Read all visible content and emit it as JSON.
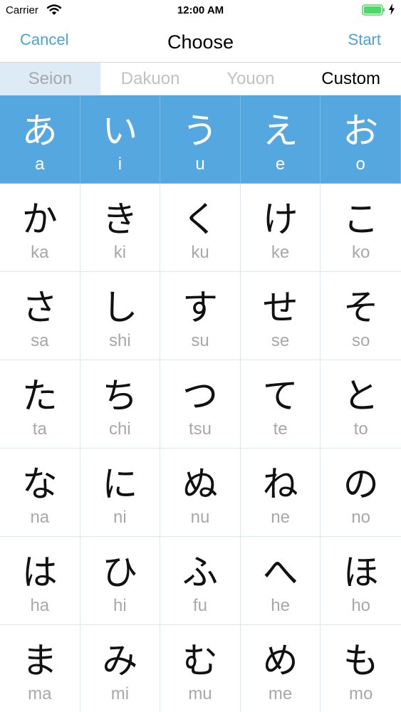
{
  "status_bar": {
    "carrier": "Carrier",
    "time": "12:00 AM"
  },
  "nav": {
    "cancel": "Cancel",
    "title": "Choose",
    "start": "Start"
  },
  "segments": [
    "Seion",
    "Dakuon",
    "Youon",
    "Custom"
  ],
  "colors": {
    "accent": "#4aa3de",
    "selected_cell": "#55a7df",
    "segment_selected_bg": "#dcebf6",
    "battery": "#4cd964"
  },
  "kana_rows": [
    [
      {
        "kana": "あ",
        "romaji": "a",
        "selected": true
      },
      {
        "kana": "い",
        "romaji": "i",
        "selected": true
      },
      {
        "kana": "う",
        "romaji": "u",
        "selected": true
      },
      {
        "kana": "え",
        "romaji": "e",
        "selected": true
      },
      {
        "kana": "お",
        "romaji": "o",
        "selected": true
      }
    ],
    [
      {
        "kana": "か",
        "romaji": "ka"
      },
      {
        "kana": "き",
        "romaji": "ki"
      },
      {
        "kana": "く",
        "romaji": "ku"
      },
      {
        "kana": "け",
        "romaji": "ke"
      },
      {
        "kana": "こ",
        "romaji": "ko"
      }
    ],
    [
      {
        "kana": "さ",
        "romaji": "sa"
      },
      {
        "kana": "し",
        "romaji": "shi"
      },
      {
        "kana": "す",
        "romaji": "su"
      },
      {
        "kana": "せ",
        "romaji": "se"
      },
      {
        "kana": "そ",
        "romaji": "so"
      }
    ],
    [
      {
        "kana": "た",
        "romaji": "ta"
      },
      {
        "kana": "ち",
        "romaji": "chi"
      },
      {
        "kana": "つ",
        "romaji": "tsu"
      },
      {
        "kana": "て",
        "romaji": "te"
      },
      {
        "kana": "と",
        "romaji": "to"
      }
    ],
    [
      {
        "kana": "な",
        "romaji": "na"
      },
      {
        "kana": "に",
        "romaji": "ni"
      },
      {
        "kana": "ぬ",
        "romaji": "nu"
      },
      {
        "kana": "ね",
        "romaji": "ne"
      },
      {
        "kana": "の",
        "romaji": "no"
      }
    ],
    [
      {
        "kana": "は",
        "romaji": "ha"
      },
      {
        "kana": "ひ",
        "romaji": "hi"
      },
      {
        "kana": "ふ",
        "romaji": "fu"
      },
      {
        "kana": "へ",
        "romaji": "he"
      },
      {
        "kana": "ほ",
        "romaji": "ho"
      }
    ],
    [
      {
        "kana": "ま",
        "romaji": "ma"
      },
      {
        "kana": "み",
        "romaji": "mi"
      },
      {
        "kana": "む",
        "romaji": "mu"
      },
      {
        "kana": "め",
        "romaji": "me"
      },
      {
        "kana": "も",
        "romaji": "mo"
      }
    ]
  ]
}
